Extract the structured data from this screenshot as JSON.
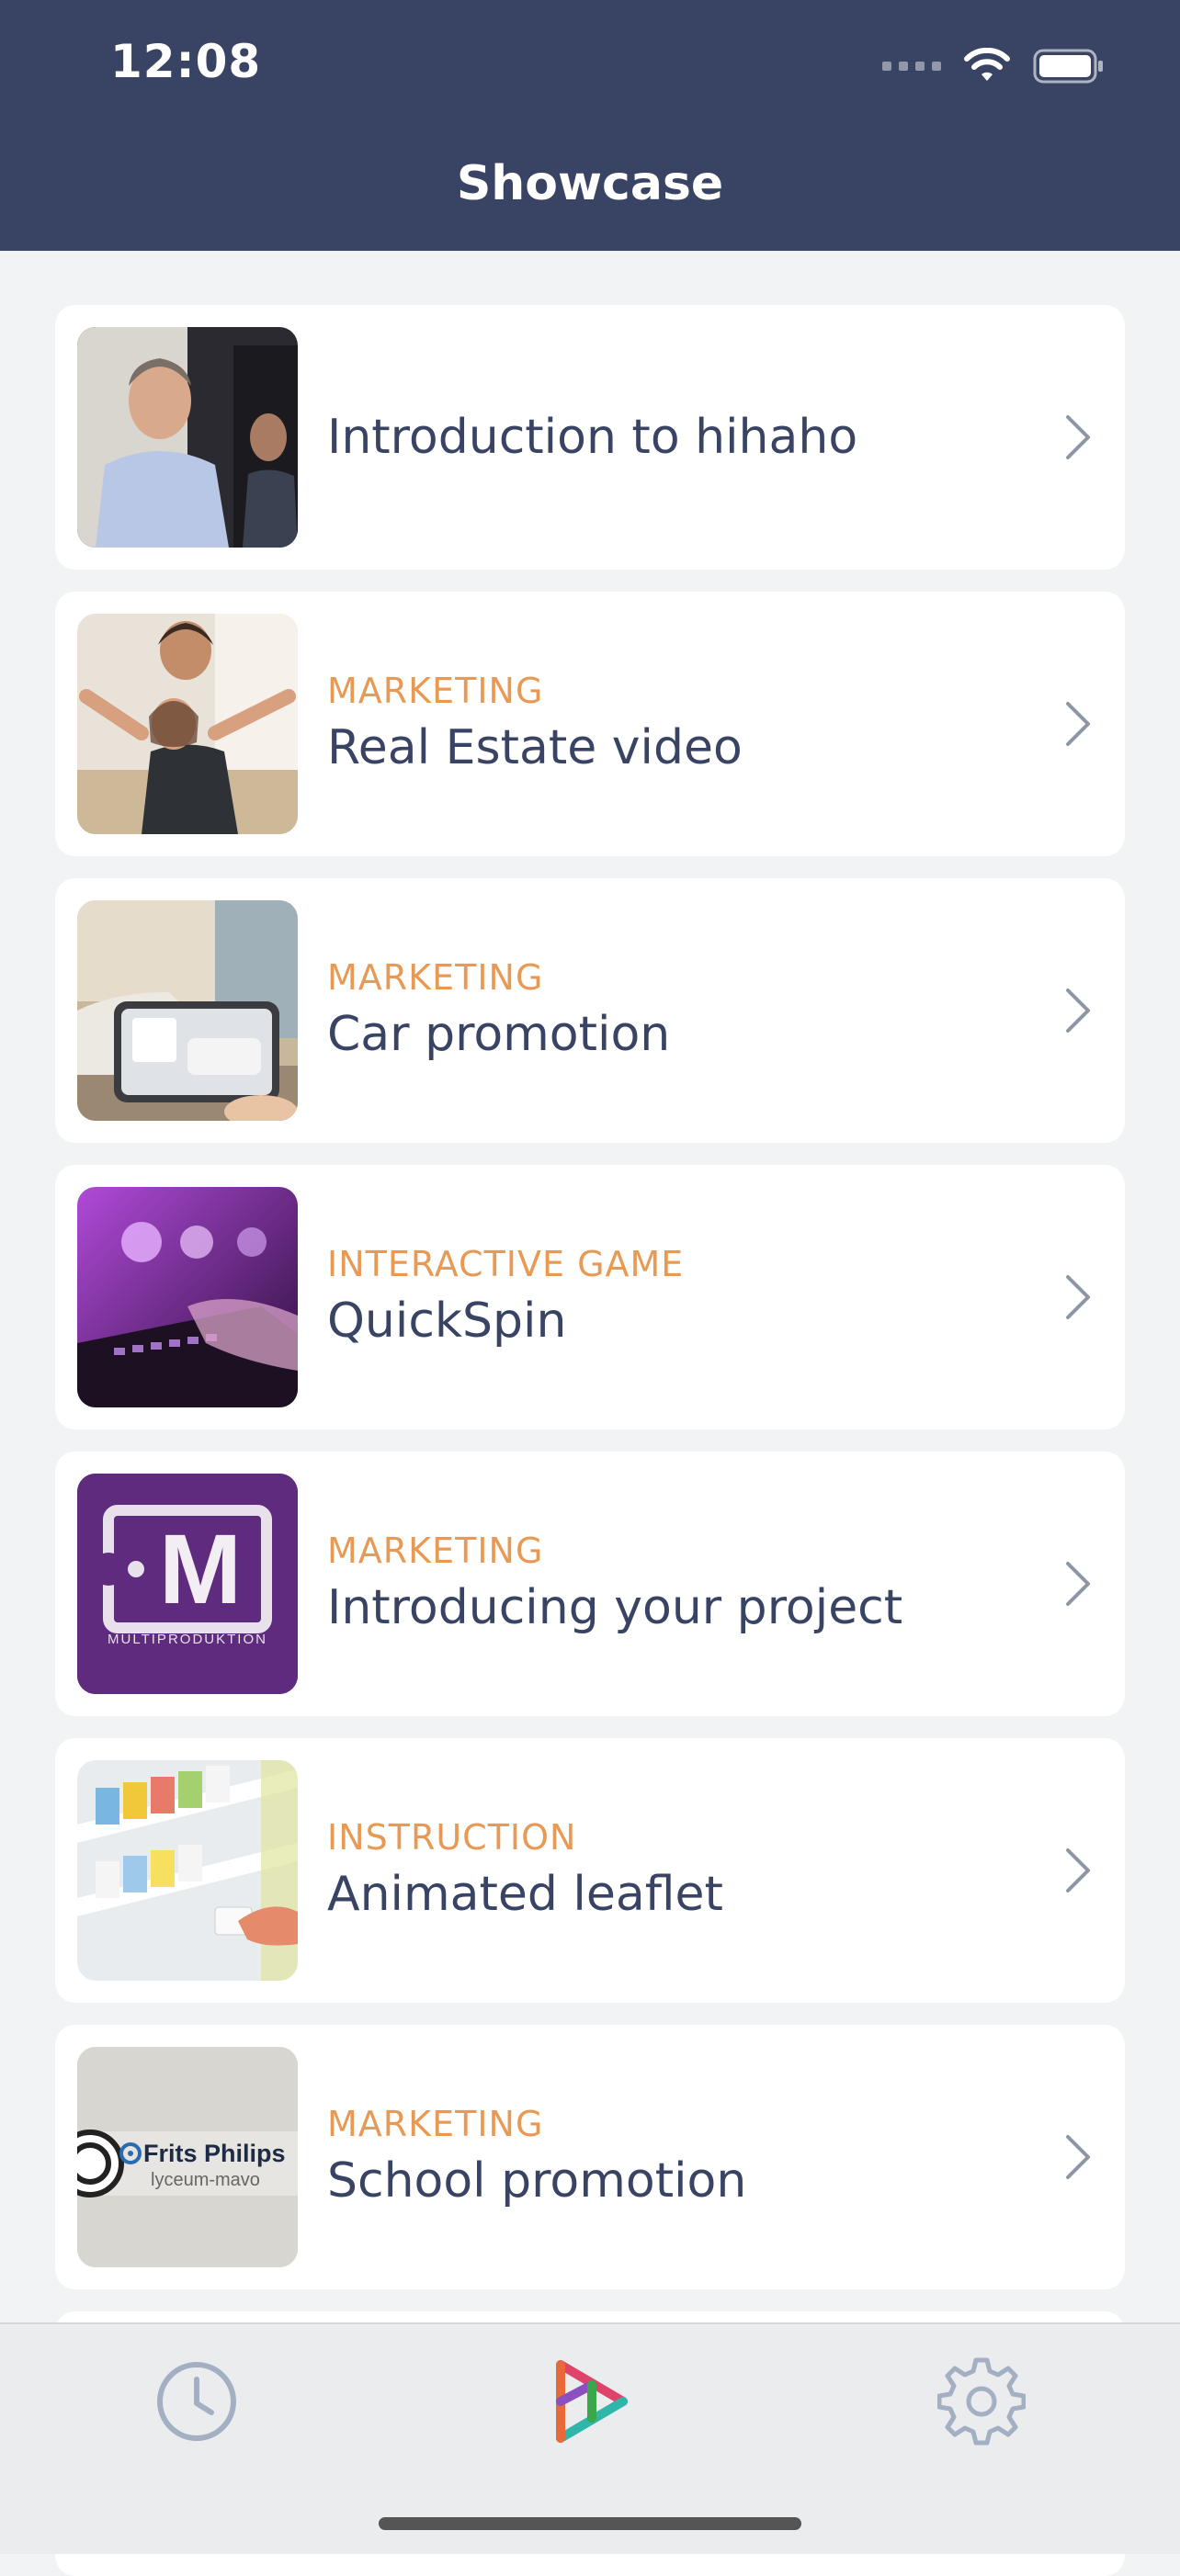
{
  "status_bar": {
    "time": "12:08"
  },
  "header": {
    "title": "Showcase"
  },
  "items": [
    {
      "category": "",
      "title": "Introduction to hihaho",
      "thumb": "presenter-photo"
    },
    {
      "category": "MARKETING",
      "title": "Real Estate video",
      "thumb": "family-photo"
    },
    {
      "category": "MARKETING",
      "title": "Car promotion",
      "thumb": "car-showroom-photo"
    },
    {
      "category": "INTERACTIVE GAME",
      "title": "QuickSpin",
      "thumb": "keyboard-photo"
    },
    {
      "category": "MARKETING",
      "title": "Introducing your project",
      "thumb": "multiproduktion-logo",
      "logo_letter": "M",
      "logo_text": "MULTIPRODUKTION"
    },
    {
      "category": "INSTRUCTION",
      "title": "Animated leaflet",
      "thumb": "pharmacy-shelf-photo"
    },
    {
      "category": "MARKETING",
      "title": "School promotion",
      "thumb": "frits-philips-logo",
      "logo_name": "Frits Philips",
      "logo_sub": "lyceum-mavo"
    }
  ],
  "tabbar": {
    "tabs": [
      {
        "name": "history",
        "icon": "clock-icon"
      },
      {
        "name": "showcase",
        "icon": "play-logo-icon",
        "active": true
      },
      {
        "name": "settings",
        "icon": "gear-icon"
      }
    ]
  },
  "colors": {
    "header": "#394464",
    "category": "#E89A55",
    "title": "#394464",
    "background": "#F2F3F5"
  }
}
